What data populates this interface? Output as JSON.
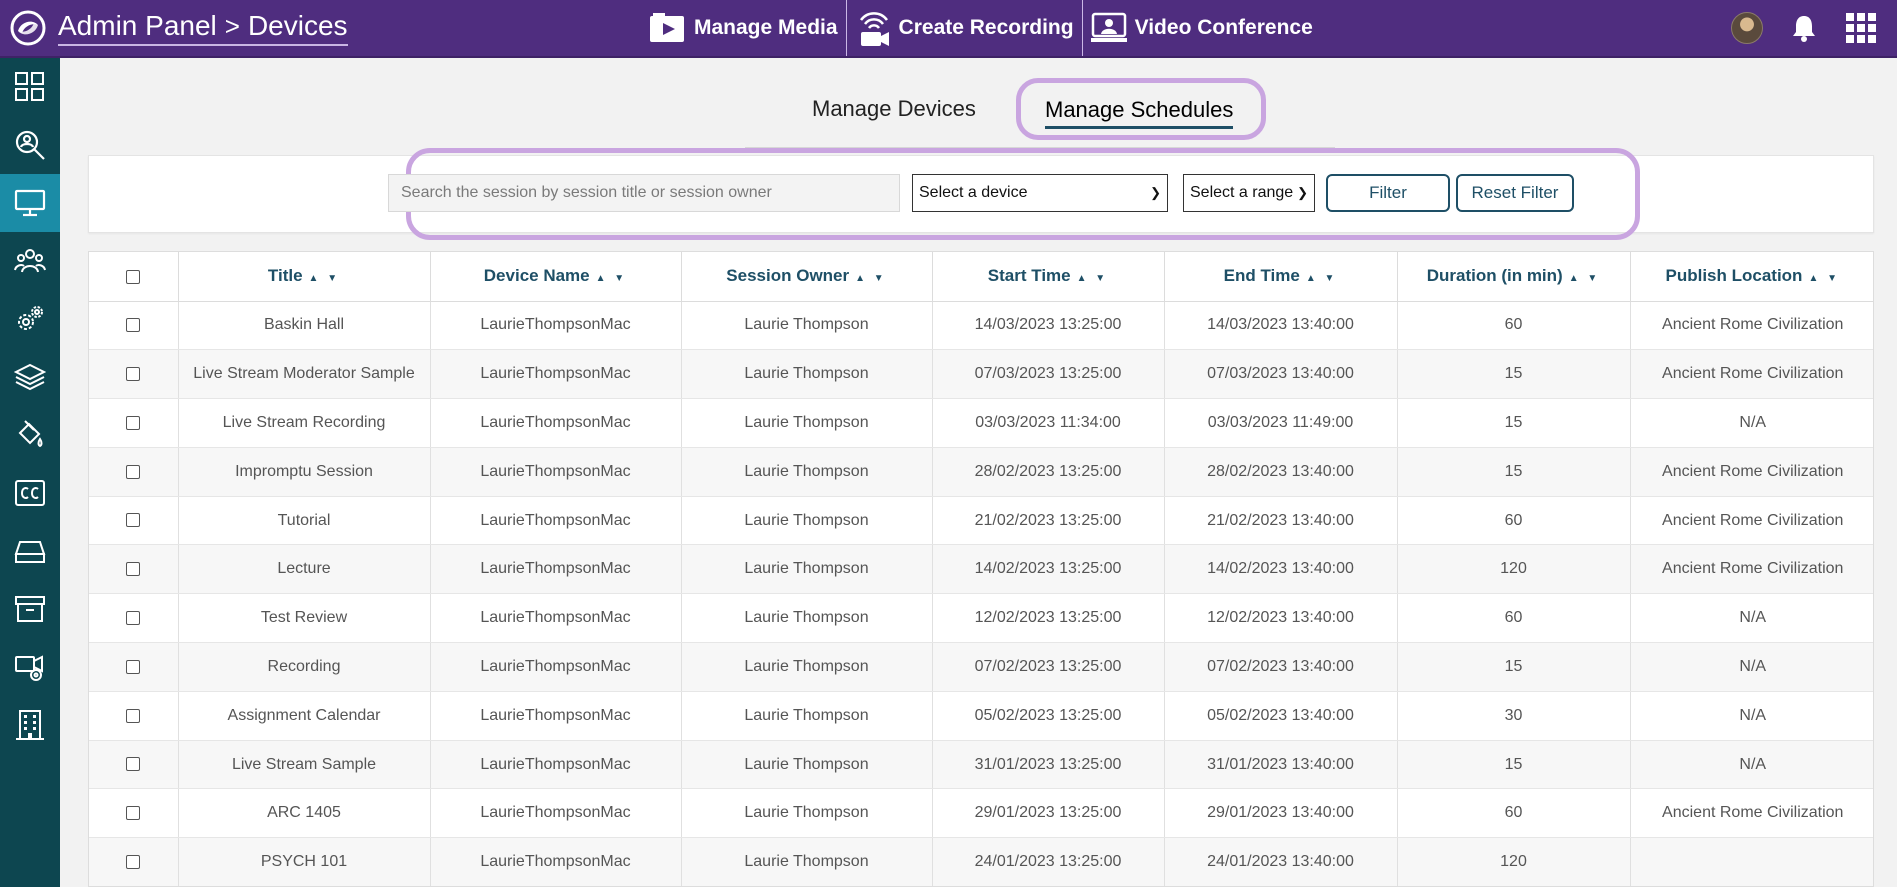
{
  "header": {
    "crumb_root": "Admin Panel",
    "crumb_sep": ">",
    "crumb_page": "Devices",
    "nav": [
      {
        "label": "Manage Media"
      },
      {
        "label": "Create Recording"
      },
      {
        "label": "Video Conference"
      }
    ]
  },
  "tabs": {
    "devices": "Manage Devices",
    "schedules": "Manage Schedules"
  },
  "filter": {
    "search_placeholder": "Search the session by session title or session owner",
    "device_select": "Select a device",
    "range_select": "Select a range",
    "filter_label": "Filter",
    "reset_label": "Reset Filter"
  },
  "table": {
    "columns": [
      "Title",
      "Device Name",
      "Session Owner",
      "Start Time",
      "End Time",
      "Duration (in min)",
      "Publish Location"
    ],
    "sort_glyph": "▲ ▼",
    "rows": [
      [
        "Baskin Hall",
        "LaurieThompsonMac",
        "Laurie Thompson",
        "14/03/2023 13:25:00",
        "14/03/2023 13:40:00",
        "60",
        "Ancient Rome Civilization"
      ],
      [
        "Live Stream Moderator Sample",
        "LaurieThompsonMac",
        "Laurie Thompson",
        "07/03/2023 13:25:00",
        "07/03/2023 13:40:00",
        "15",
        "Ancient Rome Civilization"
      ],
      [
        "Live Stream Recording",
        "LaurieThompsonMac",
        "Laurie Thompson",
        "03/03/2023 11:34:00",
        "03/03/2023 11:49:00",
        "15",
        "N/A"
      ],
      [
        "Impromptu Session",
        "LaurieThompsonMac",
        "Laurie Thompson",
        "28/02/2023 13:25:00",
        "28/02/2023 13:40:00",
        "15",
        "Ancient Rome Civilization"
      ],
      [
        "Tutorial",
        "LaurieThompsonMac",
        "Laurie Thompson",
        "21/02/2023 13:25:00",
        "21/02/2023 13:40:00",
        "60",
        "Ancient Rome Civilization"
      ],
      [
        "Lecture",
        "LaurieThompsonMac",
        "Laurie Thompson",
        "14/02/2023 13:25:00",
        "14/02/2023 13:40:00",
        "120",
        "Ancient Rome Civilization"
      ],
      [
        "Test Review",
        "LaurieThompsonMac",
        "Laurie Thompson",
        "12/02/2023 13:25:00",
        "12/02/2023 13:40:00",
        "60",
        "N/A"
      ],
      [
        "Recording",
        "LaurieThompsonMac",
        "Laurie Thompson",
        "07/02/2023 13:25:00",
        "07/02/2023 13:40:00",
        "15",
        "N/A"
      ],
      [
        "Assignment Calendar",
        "LaurieThompsonMac",
        "Laurie Thompson",
        "05/02/2023 13:25:00",
        "05/02/2023 13:40:00",
        "30",
        "N/A"
      ],
      [
        "Live Stream Sample",
        "LaurieThompsonMac",
        "Laurie Thompson",
        "31/01/2023 13:25:00",
        "31/01/2023 13:40:00",
        "15",
        "N/A"
      ],
      [
        "ARC 1405",
        "LaurieThompsonMac",
        "Laurie Thompson",
        "29/01/2023 13:25:00",
        "29/01/2023 13:40:00",
        "60",
        "Ancient Rome Civilization"
      ],
      [
        "PSYCH 101",
        "LaurieThompsonMac",
        "Laurie Thompson",
        "24/01/2023 13:25:00",
        "24/01/2023 13:40:00",
        "120",
        ""
      ]
    ]
  },
  "sidebar": {
    "items": [
      {
        "icon": "dashboard-icon"
      },
      {
        "icon": "search-users-icon"
      },
      {
        "icon": "monitor-icon",
        "active": true
      },
      {
        "icon": "users-group-icon"
      },
      {
        "icon": "gears-icon"
      },
      {
        "icon": "layers-icon"
      },
      {
        "icon": "paint-bucket-icon"
      },
      {
        "icon": "closed-caption-icon"
      },
      {
        "icon": "drive-icon"
      },
      {
        "icon": "archive-icon"
      },
      {
        "icon": "camera-settings-icon"
      },
      {
        "icon": "building-icon"
      }
    ]
  },
  "colors": {
    "topbar": "#4f2d7f",
    "sidebar": "#0d4650",
    "sidebar_active": "#1b8ca6",
    "accent": "#1e4f66",
    "highlight": "#c9a5e0"
  }
}
